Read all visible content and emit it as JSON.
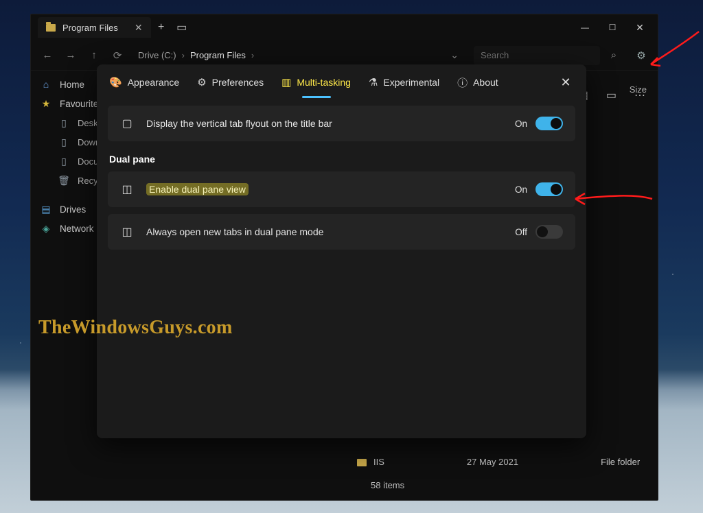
{
  "window": {
    "tab_title": "Program Files",
    "new_tab_tooltip": "+",
    "breadcrumb": {
      "root": "Drive (C:)",
      "current": "Program Files"
    },
    "search_placeholder": "Search"
  },
  "sidebar": {
    "home": "Home",
    "favourites": "Favourites",
    "fav_items": [
      "Desktop",
      "Downloads",
      "Documents",
      "Recycle Bin"
    ],
    "drives": "Drives",
    "network": "Network"
  },
  "columns": {
    "size": "Size"
  },
  "right_strip": {
    "grid": "▦",
    "card": "▭",
    "more": "⋯"
  },
  "list": {
    "row_name": "IIS",
    "row_date": "27 May 2021",
    "row_type": "File folder",
    "status": "58 items"
  },
  "modal": {
    "tabs": {
      "appearance": "Appearance",
      "preferences": "Preferences",
      "multitasking": "Multi-tasking",
      "experimental": "Experimental",
      "about": "About"
    },
    "section_dual": "Dual pane",
    "rows": {
      "vertical_tab": {
        "label": "Display the vertical tab flyout on the title bar",
        "state": "On",
        "on": true
      },
      "dual_pane": {
        "label": "Enable dual pane view",
        "state": "On",
        "on": true
      },
      "new_tabs_dual": {
        "label": "Always open new tabs in dual pane mode",
        "state": "Off",
        "on": false
      }
    }
  },
  "watermark": "TheWindowsGuys.com"
}
